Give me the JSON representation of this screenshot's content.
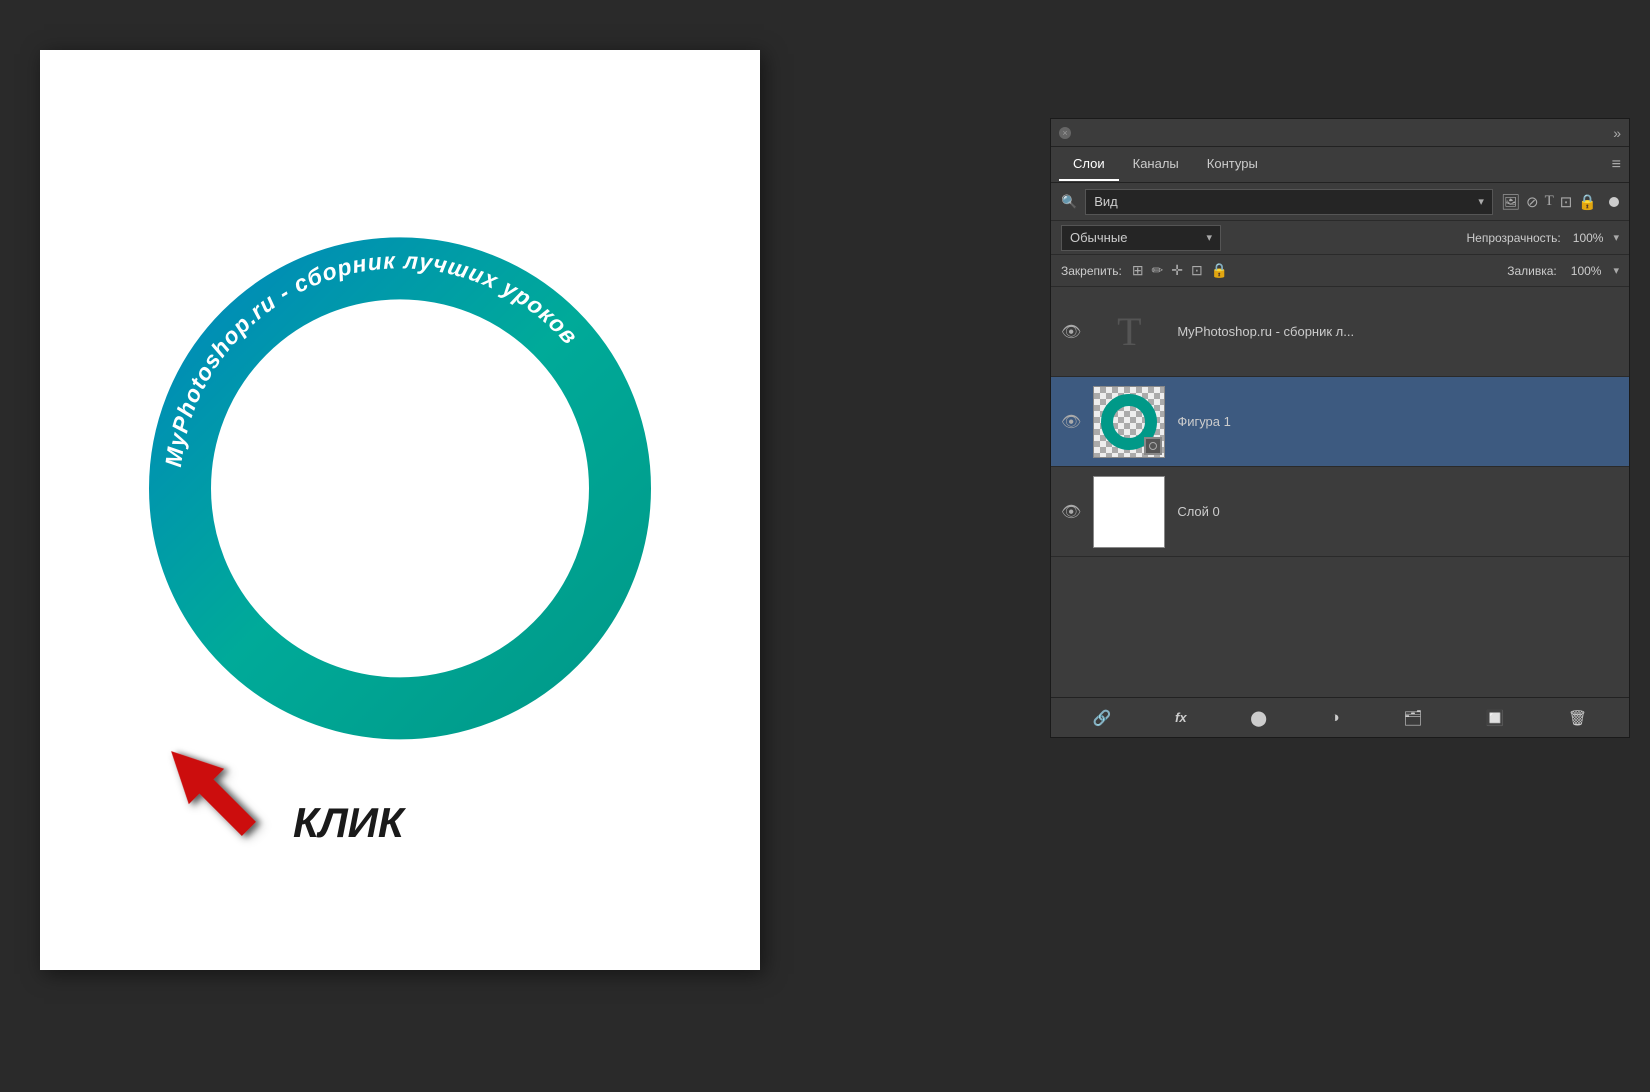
{
  "background_color": "#2a2a2a",
  "canvas": {
    "background": "white"
  },
  "circle": {
    "text": "MyPhotoshop.ru - сборник лучших уроков",
    "stroke_color_top": "#0088aa",
    "stroke_color_bottom": "#00aa88",
    "gradient_start": "#008899",
    "gradient_end": "#00bb99"
  },
  "arrow": {
    "label": "КЛИК",
    "color": "#cc0000"
  },
  "panel": {
    "close_button": "×",
    "collapse_label": "»",
    "tabs": [
      {
        "id": "layers",
        "label": "Слои",
        "active": true
      },
      {
        "id": "channels",
        "label": "Каналы",
        "active": false
      },
      {
        "id": "paths",
        "label": "Контуры",
        "active": false
      }
    ],
    "menu_icon": "≡",
    "filter": {
      "placeholder": "Вид",
      "icons": [
        "image",
        "circle",
        "T",
        "rect",
        "lock"
      ]
    },
    "blend_mode": {
      "value": "Обычные",
      "opacity_label": "Непрозрачность:",
      "opacity_value": "100%"
    },
    "lock_row": {
      "label": "Закрепить:",
      "fill_label": "Заливка:",
      "fill_value": "100%"
    },
    "layers": [
      {
        "id": "text-layer",
        "name": "MyPhotoshop.ru - сборник л...",
        "type": "text",
        "visible": true,
        "active": false,
        "thumb_type": "text"
      },
      {
        "id": "shape-layer",
        "name": "Фигура 1",
        "type": "shape",
        "visible": true,
        "active": true,
        "thumb_type": "shape"
      },
      {
        "id": "background-layer",
        "name": "Слой 0",
        "type": "raster",
        "visible": true,
        "active": false,
        "thumb_type": "white"
      }
    ],
    "bottom_tools": [
      {
        "id": "link",
        "icon": "🔗"
      },
      {
        "id": "fx",
        "icon": "fx"
      },
      {
        "id": "mask",
        "icon": "⬤"
      },
      {
        "id": "adjustment",
        "icon": "◑"
      },
      {
        "id": "group",
        "icon": "📁"
      },
      {
        "id": "new-layer",
        "icon": "⬜"
      },
      {
        "id": "delete",
        "icon": "🗑"
      }
    ]
  }
}
